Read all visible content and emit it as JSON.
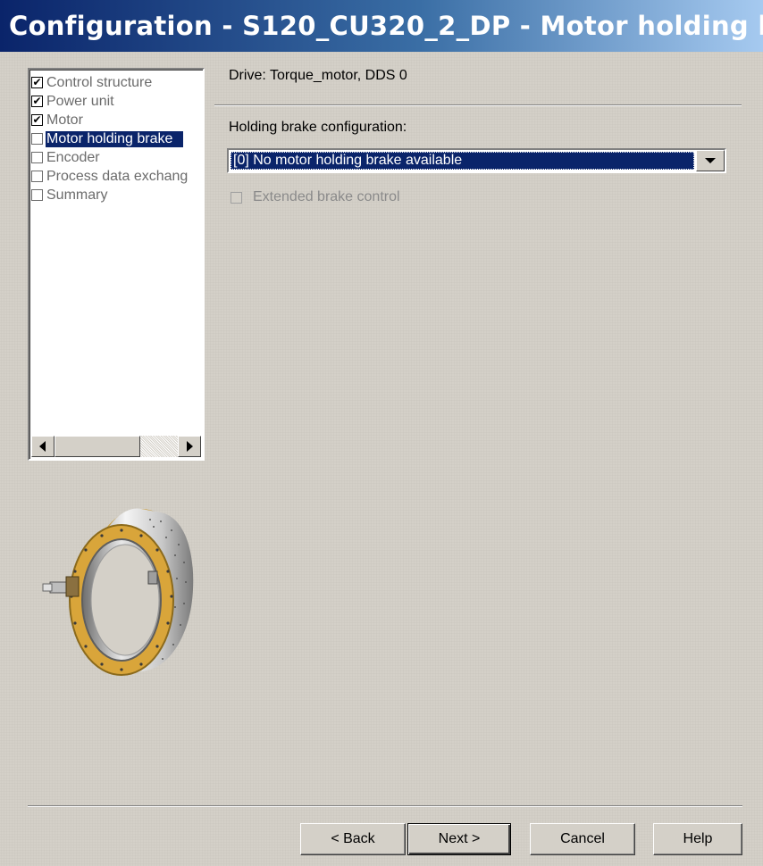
{
  "window": {
    "title": "Configuration - S120_CU320_2_DP - Motor holding b.."
  },
  "steps": [
    {
      "label": "Control structure",
      "checked": true,
      "selected": false
    },
    {
      "label": "Power unit",
      "checked": true,
      "selected": false
    },
    {
      "label": "Motor",
      "checked": true,
      "selected": false
    },
    {
      "label": "Motor holding brake",
      "checked": false,
      "selected": true
    },
    {
      "label": "Encoder",
      "checked": false,
      "selected": false
    },
    {
      "label": "Process data exchang",
      "checked": false,
      "selected": false
    },
    {
      "label": "Summary",
      "checked": false,
      "selected": false
    }
  ],
  "content": {
    "drive_label": "Drive: Torque_motor, DDS 0",
    "holding_brake_label": "Holding brake configuration:",
    "holding_brake_value": "[0] No motor holding brake available",
    "extended_brake_label": "Extended brake control",
    "extended_brake_checked": false
  },
  "buttons": {
    "back": "< Back",
    "next": "Next >",
    "cancel": "Cancel",
    "help": "Help"
  },
  "icons": {
    "scroll_left": "arrow-left-icon",
    "scroll_right": "arrow-right-icon",
    "dropdown": "chevron-down-icon",
    "checkmark": "check-icon"
  },
  "colors": {
    "title_bar": "#0a246a",
    "selection": "#0a246a",
    "dialog_bg": "#d4d0c8",
    "motor_ring": "#d9a53a"
  }
}
